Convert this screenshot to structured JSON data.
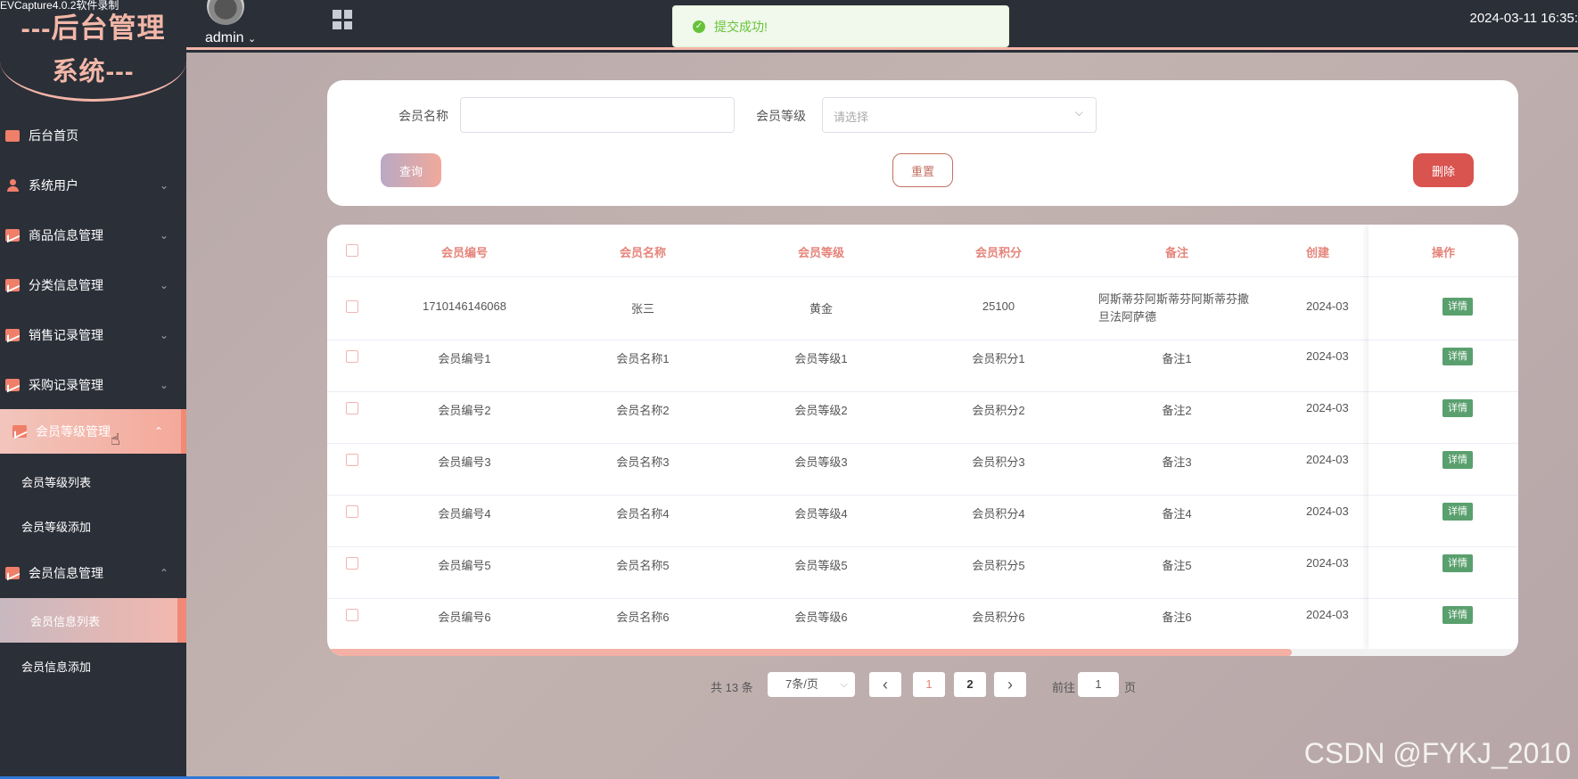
{
  "header": {
    "capture_tag": "EVCapture4.0.2软件录制",
    "logo_line1": "---后台管理",
    "logo_line2": "系统---",
    "username": "admin",
    "username_caret": "⌄",
    "datetime": "2024-03-11 16:35:",
    "toast": "提交成功!"
  },
  "sidebar": {
    "items": [
      {
        "label": "后台首页",
        "icon": "monitor-icon"
      },
      {
        "label": "系统用户",
        "icon": "user-icon",
        "arrow": "⌄"
      },
      {
        "label": "商品信息管理",
        "icon": "chart-icon",
        "arrow": "⌄"
      },
      {
        "label": "分类信息管理",
        "icon": "chart-icon",
        "arrow": "⌄"
      },
      {
        "label": "销售记录管理",
        "icon": "chart-icon",
        "arrow": "⌄"
      },
      {
        "label": "采购记录管理",
        "icon": "chart-icon",
        "arrow": "⌄"
      },
      {
        "label": "会员等级管理",
        "icon": "chart-icon",
        "arrow": "⌃"
      },
      {
        "label": "会员信息管理",
        "icon": "chart-icon",
        "arrow": "⌃"
      }
    ],
    "sub_level": [
      "会员等级列表",
      "会员等级添加"
    ],
    "sub_info": [
      "会员信息列表",
      "会员信息添加"
    ]
  },
  "search": {
    "name_label": "会员名称",
    "name_value": "",
    "level_label": "会员等级",
    "level_placeholder": "请选择",
    "query": "查询",
    "reset": "重置",
    "delete": "删除"
  },
  "table": {
    "headers": [
      "会员编号",
      "会员名称",
      "会员等级",
      "会员积分",
      "备注",
      "创建",
      "操作"
    ],
    "detail_label": "详情",
    "rows": [
      {
        "id": "1710146146068",
        "name": "张三",
        "level": "黄金",
        "points": "25100",
        "note": "阿斯蒂芬阿斯蒂芬阿斯蒂芬撒旦法阿萨德",
        "created": "2024-03"
      },
      {
        "id": "会员编号1",
        "name": "会员名称1",
        "level": "会员等级1",
        "points": "会员积分1",
        "note": "备注1",
        "created": "2024-03"
      },
      {
        "id": "会员编号2",
        "name": "会员名称2",
        "level": "会员等级2",
        "points": "会员积分2",
        "note": "备注2",
        "created": "2024-03"
      },
      {
        "id": "会员编号3",
        "name": "会员名称3",
        "level": "会员等级3",
        "points": "会员积分3",
        "note": "备注3",
        "created": "2024-03"
      },
      {
        "id": "会员编号4",
        "name": "会员名称4",
        "level": "会员等级4",
        "points": "会员积分4",
        "note": "备注4",
        "created": "2024-03"
      },
      {
        "id": "会员编号5",
        "name": "会员名称5",
        "level": "会员等级5",
        "points": "会员积分5",
        "note": "备注5",
        "created": "2024-03"
      },
      {
        "id": "会员编号6",
        "name": "会员名称6",
        "level": "会员等级6",
        "points": "会员积分6",
        "note": "备注6",
        "created": "2024-03"
      }
    ]
  },
  "pagination": {
    "total": "共 13 条",
    "page_size": "7条/页",
    "prev": "‹",
    "next": "›",
    "pages": [
      "1",
      "2"
    ],
    "goto_label": "前往",
    "goto_value": "1",
    "goto_suffix": "页"
  },
  "watermark": "CSDN @FYKJ_2010",
  "colors": {
    "accent": "#f08a76",
    "header_text": "#e5847a",
    "danger": "#d9534f",
    "success": "#5aa06e"
  }
}
